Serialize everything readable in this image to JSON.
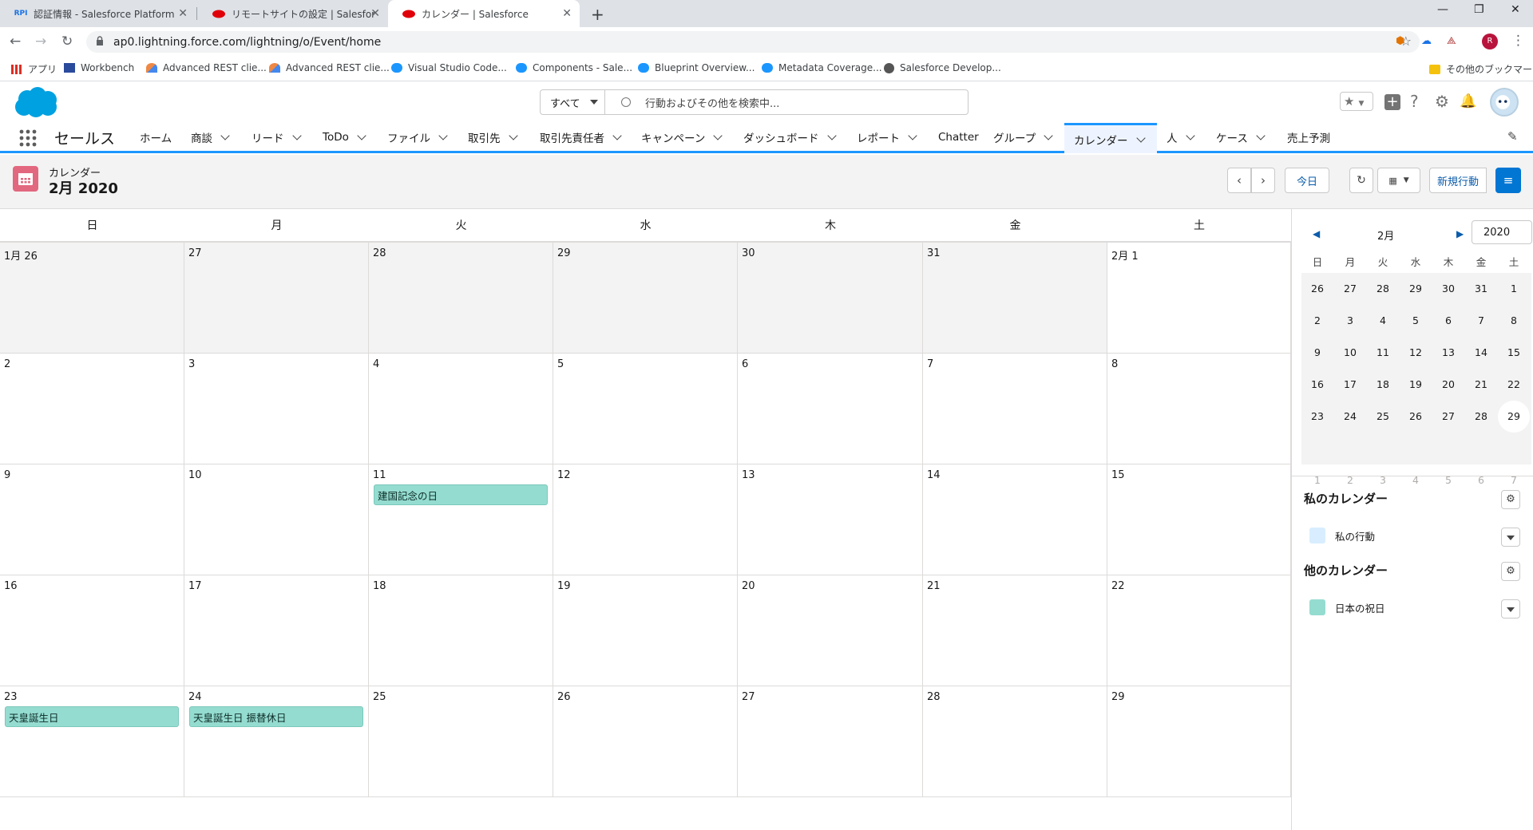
{
  "browser": {
    "tabs": [
      {
        "title": "認証情報 - Salesforce Platform A",
        "favicon": "api-icon"
      },
      {
        "title": "リモートサイトの設定 | Salesforce",
        "favicon": "salesforce-icon"
      },
      {
        "title": "カレンダー | Salesforce",
        "favicon": "salesforce-icon"
      }
    ],
    "url": "ap0.lightning.force.com/lightning/o/Event/home",
    "bookmarks": [
      "アプリ",
      "Workbench",
      "Advanced REST clie...",
      "Advanced REST clie...",
      "Visual Studio Code...",
      "Components - Sale...",
      "Blueprint Overview...",
      "Metadata Coverage...",
      "Salesforce Develop..."
    ],
    "other_bookmarks": "その他のブックマーク",
    "profile_initial": "R"
  },
  "header": {
    "scope": "すべて",
    "search_placeholder": "行動およびその他を検索中..."
  },
  "nav": {
    "app_name": "セールス",
    "items": [
      {
        "label": "ホーム"
      },
      {
        "label": "商談"
      },
      {
        "label": "リード"
      },
      {
        "label": "ToDo"
      },
      {
        "label": "ファイル"
      },
      {
        "label": "取引先"
      },
      {
        "label": "取引先責任者"
      },
      {
        "label": "キャンペーン"
      },
      {
        "label": "ダッシュボード"
      },
      {
        "label": "レポート"
      },
      {
        "label": "Chatter"
      },
      {
        "label": "グループ"
      },
      {
        "label": "カレンダー"
      },
      {
        "label": "人"
      },
      {
        "label": "ケース"
      },
      {
        "label": "売上予測"
      }
    ]
  },
  "page": {
    "object_label": "カレンダー",
    "title": "2月 2020",
    "today_button": "今日",
    "new_event_button": "新規行動"
  },
  "calendar": {
    "weekdays": [
      "日",
      "月",
      "火",
      "水",
      "木",
      "金",
      "土"
    ],
    "weeks": [
      [
        "1月 26",
        "27",
        "28",
        "29",
        "30",
        "31",
        "2月 1"
      ],
      [
        "2",
        "3",
        "4",
        "5",
        "6",
        "7",
        "8"
      ],
      [
        "9",
        "10",
        "11",
        "12",
        "13",
        "14",
        "15"
      ],
      [
        "16",
        "17",
        "18",
        "19",
        "20",
        "21",
        "22"
      ],
      [
        "23",
        "24",
        "25",
        "26",
        "27",
        "28",
        "29"
      ]
    ],
    "events": [
      {
        "title": "建国記念の日",
        "week": 2,
        "day": 2
      },
      {
        "title": "天皇誕生日",
        "week": 4,
        "day": 0
      },
      {
        "title": "天皇誕生日 振替休日",
        "week": 4,
        "day": 1
      }
    ]
  },
  "mini_calendar": {
    "month": "2月",
    "year": "2020",
    "weekdays": [
      "日",
      "月",
      "火",
      "水",
      "木",
      "金",
      "土"
    ],
    "weeks": [
      [
        "26",
        "27",
        "28",
        "29",
        "30",
        "31",
        "1"
      ],
      [
        "2",
        "3",
        "4",
        "5",
        "6",
        "7",
        "8"
      ],
      [
        "9",
        "10",
        "11",
        "12",
        "13",
        "14",
        "15"
      ],
      [
        "16",
        "17",
        "18",
        "19",
        "20",
        "21",
        "22"
      ],
      [
        "23",
        "24",
        "25",
        "26",
        "27",
        "28",
        "29"
      ],
      [
        "1",
        "2",
        "3",
        "4",
        "5",
        "6",
        "7"
      ]
    ],
    "today": "29"
  },
  "my_calendars": {
    "heading": "私のカレンダー",
    "items": [
      {
        "label": "私の行動",
        "color": "#d8edff"
      }
    ]
  },
  "other_calendars": {
    "heading": "他のカレンダー",
    "items": [
      {
        "label": "日本の祝日",
        "color": "#95dcd0"
      }
    ]
  },
  "colors": {
    "brand_blue": "#1b96ff",
    "calendar_icon": "#e2687f",
    "holiday_event": "#95dcd0"
  }
}
